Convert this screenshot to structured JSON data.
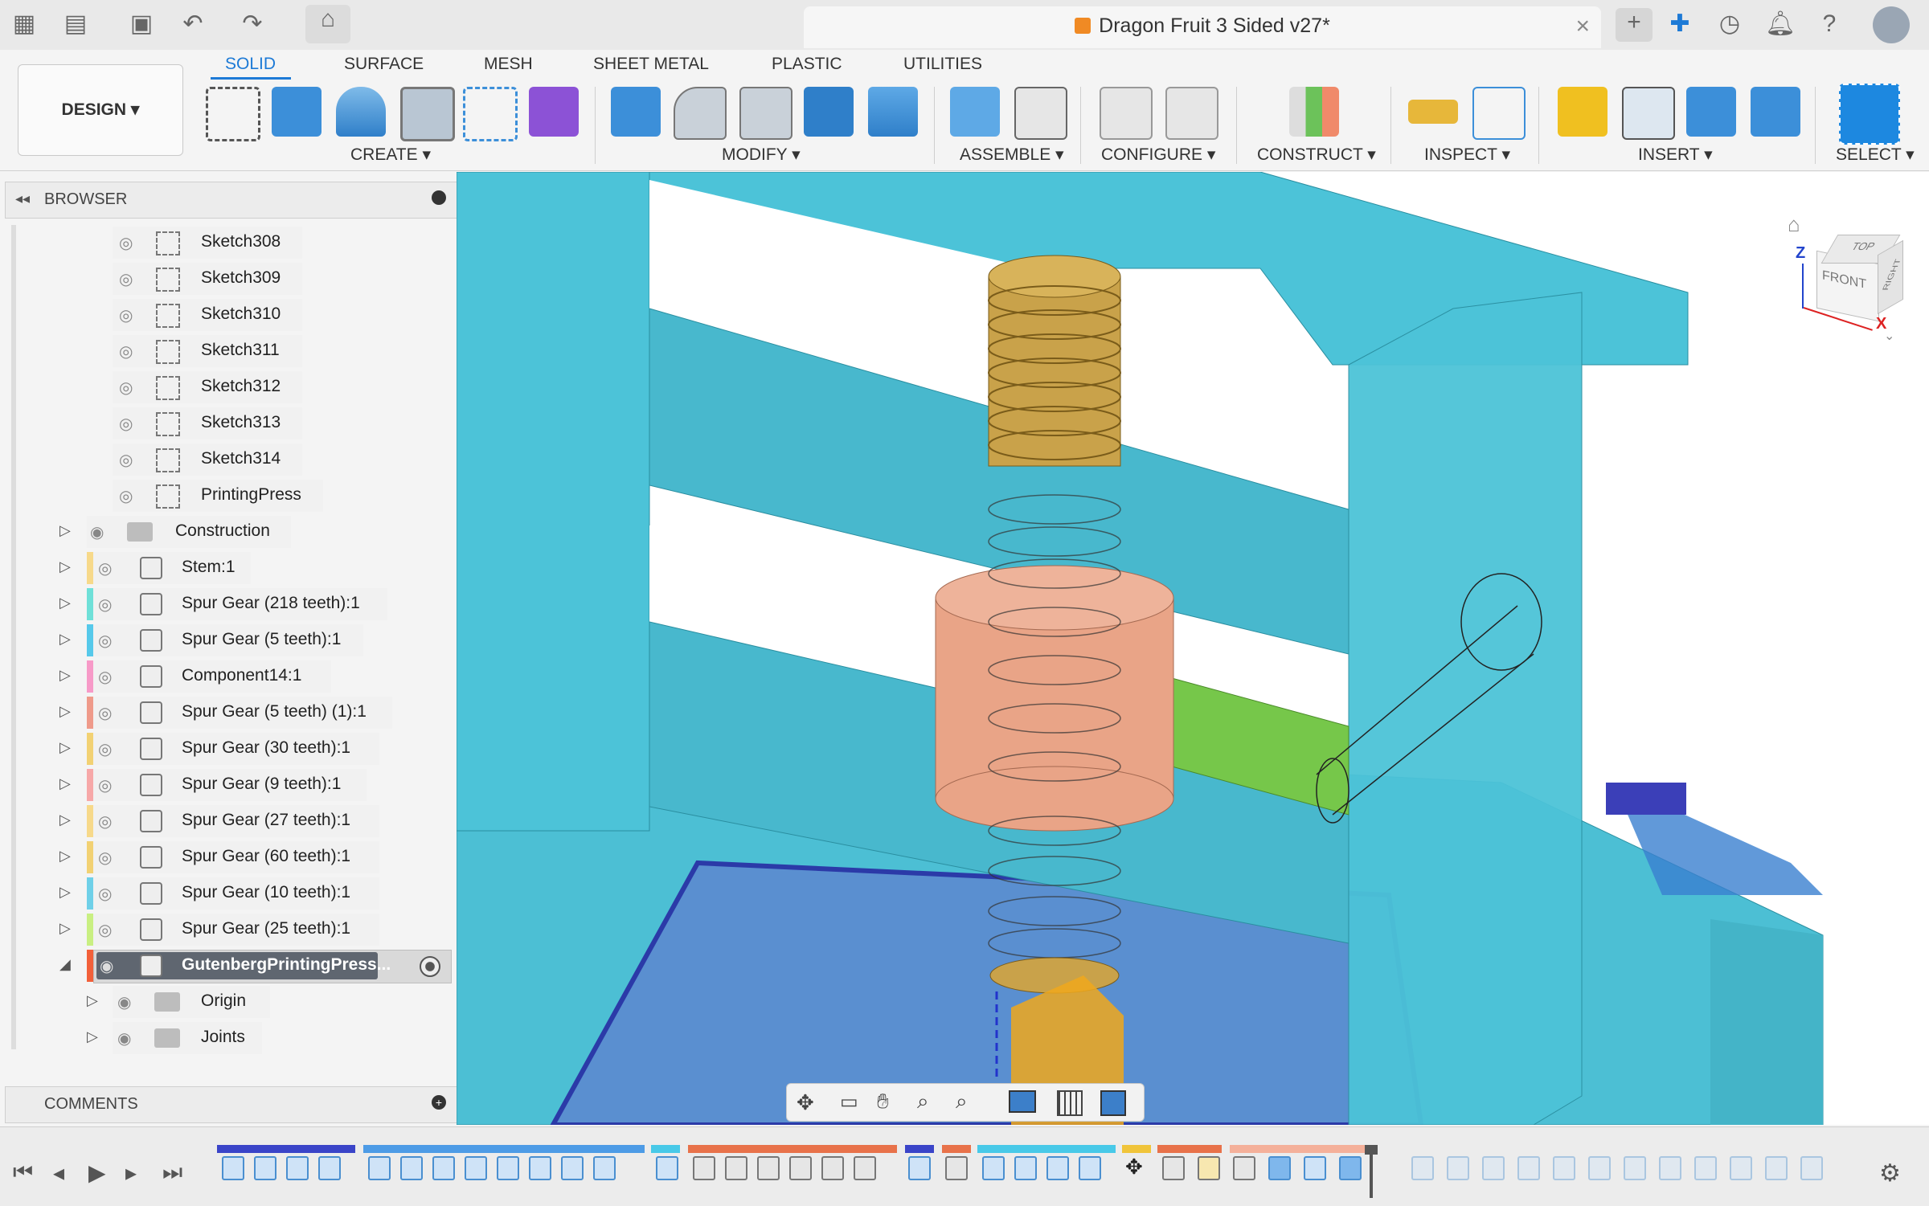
{
  "window": {
    "title": "Dragon Fruit 3 Sided v27*"
  },
  "ribbon": {
    "workspace_label": "DESIGN",
    "tabs": [
      {
        "label": "SOLID"
      },
      {
        "label": "SURFACE"
      },
      {
        "label": "MESH"
      },
      {
        "label": "SHEET METAL"
      },
      {
        "label": "PLASTIC"
      },
      {
        "label": "UTILITIES"
      }
    ],
    "groups": [
      {
        "label": "CREATE"
      },
      {
        "label": "MODIFY"
      },
      {
        "label": "ASSEMBLE"
      },
      {
        "label": "CONFIGURE"
      },
      {
        "label": "CONSTRUCT"
      },
      {
        "label": "INSPECT"
      },
      {
        "label": "INSERT"
      },
      {
        "label": "SELECT"
      }
    ]
  },
  "browser": {
    "title": "BROWSER",
    "sketches": [
      {
        "label": "Sketch308"
      },
      {
        "label": "Sketch309"
      },
      {
        "label": "Sketch310"
      },
      {
        "label": "Sketch311"
      },
      {
        "label": "Sketch312"
      },
      {
        "label": "Sketch313"
      },
      {
        "label": "Sketch314"
      },
      {
        "label": "PrintingPress"
      }
    ],
    "construction": {
      "label": "Construction"
    },
    "components": [
      {
        "label": "Stem:1",
        "color": "#f7d98a"
      },
      {
        "label": "Spur Gear (218 teeth):1",
        "color": "#6fe0d8"
      },
      {
        "label": "Spur Gear (5 teeth):1",
        "color": "#56c9ea"
      },
      {
        "label": "Component14:1",
        "color": "#f79ac8"
      },
      {
        "label": "Spur Gear (5 teeth) (1):1",
        "color": "#ef9a8a"
      },
      {
        "label": "Spur Gear (30 teeth):1",
        "color": "#f2d173"
      },
      {
        "label": "Spur Gear (9 teeth):1",
        "color": "#f7a8a8"
      },
      {
        "label": "Spur Gear (27 teeth):1",
        "color": "#f7d98a"
      },
      {
        "label": "Spur Gear (60 teeth):1",
        "color": "#f2d173"
      },
      {
        "label": "Spur Gear (10 teeth):1",
        "color": "#6fd0e8"
      },
      {
        "label": "Spur Gear (25 teeth):1",
        "color": "#c9ef82"
      }
    ],
    "active_component": {
      "label": "GutenbergPrintingPress...",
      "color": "#f2603a"
    },
    "children": [
      {
        "label": "Origin"
      },
      {
        "label": "Joints"
      }
    ]
  },
  "comments": {
    "title": "COMMENTS"
  },
  "viewcube": {
    "top": "TOP",
    "front": "FRONT",
    "right": "RIGHT",
    "axis_z": "Z",
    "axis_x": "X"
  }
}
